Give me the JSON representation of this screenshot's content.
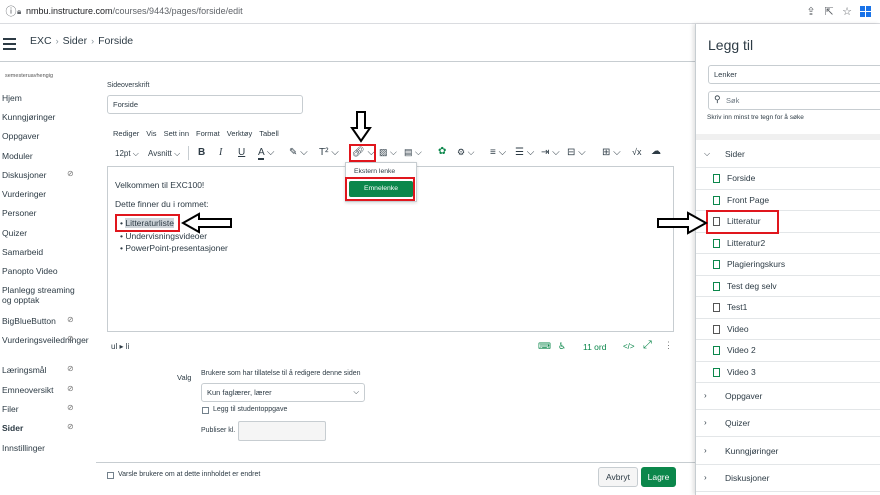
{
  "browser": {
    "url_host": "nmbu.instructure.com",
    "url_path": "/courses/9443/pages/forside/edit"
  },
  "breadcrumb": {
    "course": "EXC",
    "section": "Sider",
    "page": "Forside"
  },
  "course_nav": {
    "subtitle": "semesteruavhengig",
    "items": [
      {
        "label": "Hjem"
      },
      {
        "label": "Kunngjøringer"
      },
      {
        "label": "Oppgaver"
      },
      {
        "label": "Moduler"
      },
      {
        "label": "Diskusjoner"
      },
      {
        "label": "Vurderinger"
      },
      {
        "label": "Personer"
      },
      {
        "label": "Quizer"
      },
      {
        "label": "Samarbeid"
      },
      {
        "label": "Panopto Video"
      },
      {
        "label": "Planlegg streaming og opptak"
      },
      {
        "label": "BigBlueButton"
      },
      {
        "label": "Vurderingsveiledninger"
      },
      {
        "label": "Læringsmål"
      },
      {
        "label": "Emneoversikt"
      },
      {
        "label": "Filer"
      },
      {
        "label": "Sider"
      },
      {
        "label": "Innstillinger"
      }
    ]
  },
  "form": {
    "title_label": "Sideoverskrift",
    "title_value": "Forside",
    "menubar": [
      "Rediger",
      "Vis",
      "Sett inn",
      "Format",
      "Verktøy",
      "Tabell"
    ],
    "font_size": "12pt",
    "paragraph": "Avsnitt",
    "editor": {
      "line1": "Velkommen til EXC100!",
      "line2": "Dette finner du i rommet:",
      "bullets": [
        "Litteraturliste",
        "Undervisningsvideoer",
        "PowerPoint-presentasjoner"
      ]
    },
    "status_path": "ul ▸ li",
    "word_count": "11 ord",
    "html_toggle": "</>",
    "link_menu": {
      "external": "Ekstern lenke",
      "course": "Emnelenke"
    },
    "options_label": "Valg",
    "edit_perm_label": "Brukere som har tillatelse til å redigere denne siden",
    "edit_perm_value": "Kun faglærer, lærer",
    "todo_label": "Legg til studentoppgave",
    "publish_label": "Publiser kl.",
    "notify_label": "Varsle brukere om at dette innholdet er endret",
    "cancel_label": "Avbryt",
    "save_label": "Lagre"
  },
  "tray": {
    "title": "Legg til",
    "type_value": "Lenker",
    "search_placeholder": "Søk",
    "search_hint": "Skriv inn minst tre tegn for å søke",
    "section_sider": "Sider",
    "pages": [
      {
        "label": "Forside",
        "published": true
      },
      {
        "label": "Front Page",
        "published": true
      },
      {
        "label": "Litteratur",
        "published": false
      },
      {
        "label": "Litteratur2",
        "published": true
      },
      {
        "label": "Plagieringskurs",
        "published": true
      },
      {
        "label": "Test deg selv",
        "published": true
      },
      {
        "label": "Test1",
        "published": false
      },
      {
        "label": "Video",
        "published": false
      },
      {
        "label": "Video 2",
        "published": true
      },
      {
        "label": "Video 3",
        "published": true
      }
    ],
    "sections": [
      "Oppgaver",
      "Quizer",
      "Kunngjøringer",
      "Diskusjoner"
    ]
  },
  "colors": {
    "accent": "#0b874b",
    "annotation": "#e0161d",
    "text": "#2d3b45"
  }
}
